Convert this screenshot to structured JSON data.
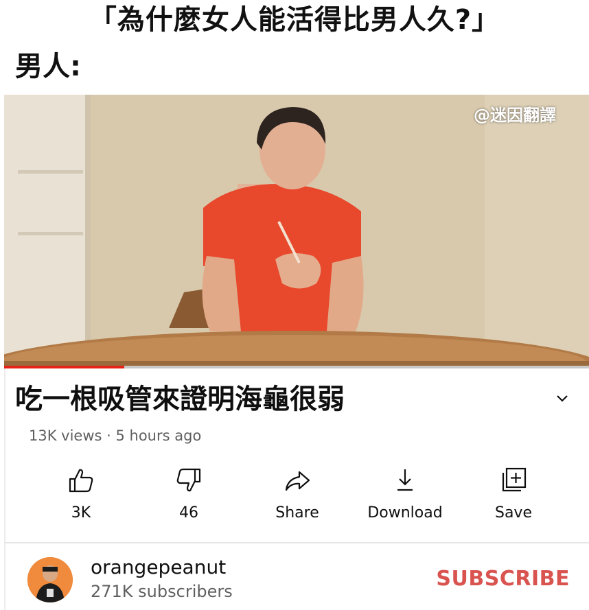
{
  "meme": {
    "top_caption": "「為什麼女人能活得比男人久?」",
    "second_caption": "男人:"
  },
  "video": {
    "watermark": "@迷因翻譯",
    "progress_fraction": 0.205,
    "title": "吃一根吸管來證明海龜很弱",
    "meta": "13K views · 5 hours ago"
  },
  "actions": [
    {
      "label": "3K",
      "icon": "thumbs-up-icon"
    },
    {
      "label": "46",
      "icon": "thumbs-down-icon"
    },
    {
      "label": "Share",
      "icon": "share-icon"
    },
    {
      "label": "Download",
      "icon": "download-icon"
    },
    {
      "label": "Save",
      "icon": "save-playlist-icon"
    }
  ],
  "channel": {
    "name": "orangepeanut",
    "subscribers": "271K subscribers",
    "subscribe_label": "SUBSCRIBE"
  },
  "colors": {
    "accent_red": "#e62117",
    "subscribe": "#d9534f",
    "shirt": "#e8482c"
  }
}
